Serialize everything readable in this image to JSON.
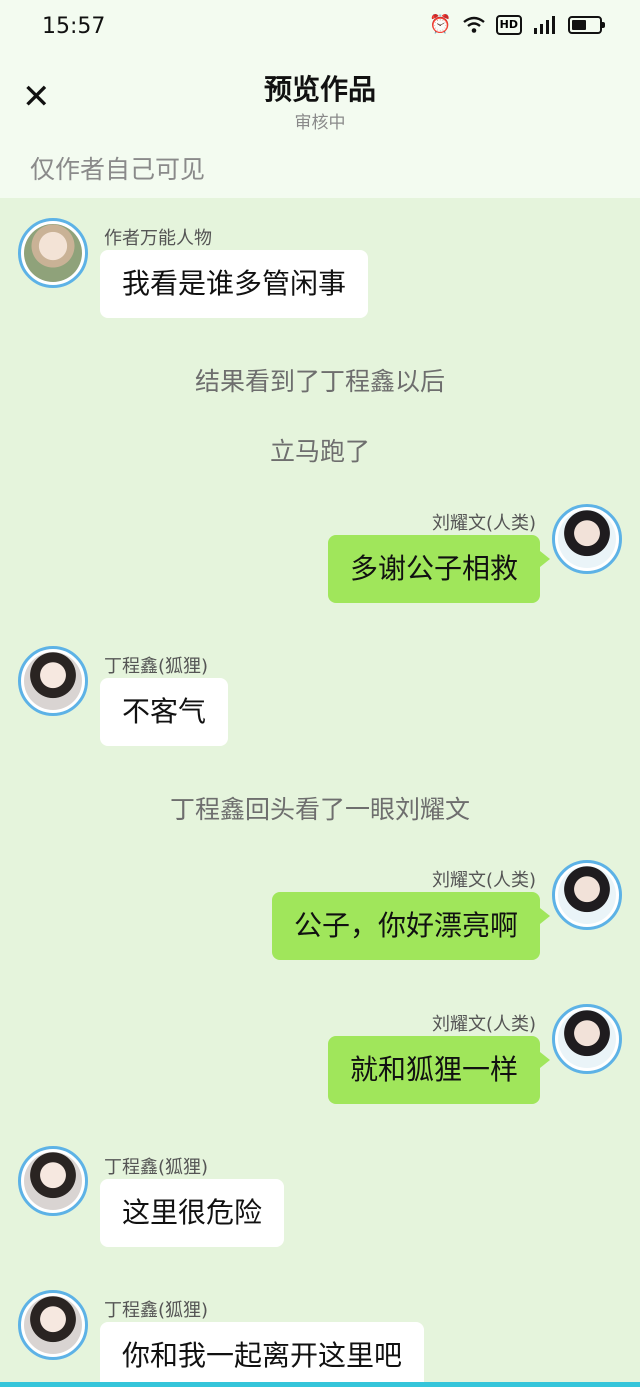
{
  "status_bar": {
    "time": "15:57"
  },
  "header": {
    "title": "预览作品",
    "subtitle": "审核中"
  },
  "visibility_note": "仅作者自己可见",
  "messages": [
    {
      "name": "作者万能人物",
      "text": "我看是谁多管闲事"
    },
    {
      "text": "结果看到了丁程鑫以后"
    },
    {
      "text": "立马跑了"
    },
    {
      "name": "刘耀文(人类)",
      "text": "多谢公子相救"
    },
    {
      "name": "丁程鑫(狐狸)",
      "text": "不客气"
    },
    {
      "text": "丁程鑫回头看了一眼刘耀文"
    },
    {
      "name": "刘耀文(人类)",
      "text": "公子，你好漂亮啊"
    },
    {
      "name": "刘耀文(人类)",
      "text": "就和狐狸一样"
    },
    {
      "name": "丁程鑫(狐狸)",
      "text": "这里很危险"
    },
    {
      "name": "丁程鑫(狐狸)",
      "text": "你和我一起离开这里吧"
    }
  ]
}
